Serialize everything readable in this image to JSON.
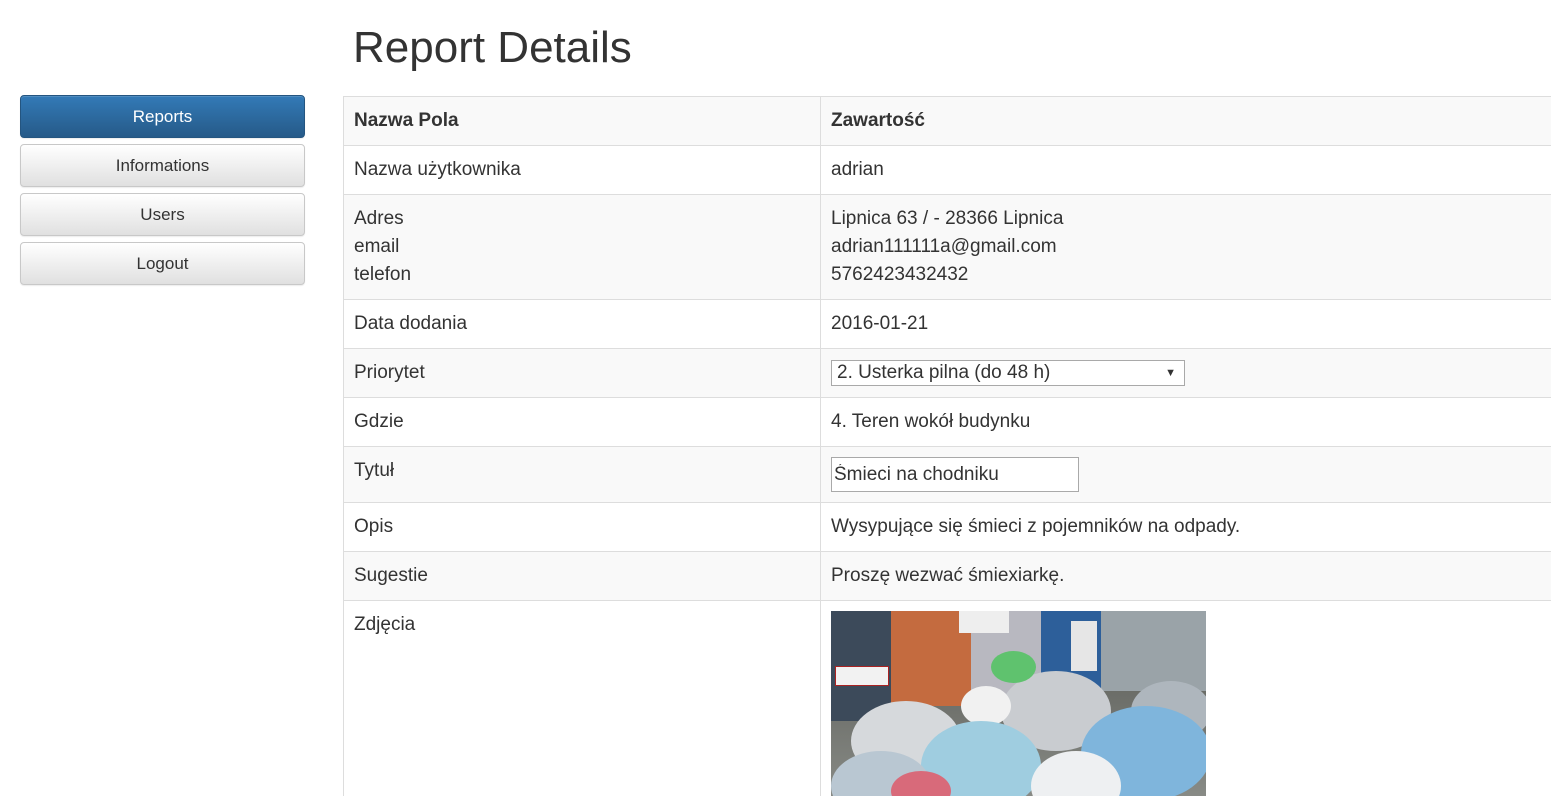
{
  "page": {
    "title": "Report Details"
  },
  "sidebar": {
    "items": [
      {
        "label": "Reports",
        "active": true
      },
      {
        "label": "Informations",
        "active": false
      },
      {
        "label": "Users",
        "active": false
      },
      {
        "label": "Logout",
        "active": false
      }
    ]
  },
  "table": {
    "headers": {
      "field": "Nazwa Pola",
      "content": "Zawartość"
    },
    "rows": {
      "username": {
        "label": "Nazwa użytkownika",
        "value": "adrian"
      },
      "contact": {
        "labels": [
          "Adres",
          "email",
          "telefon"
        ],
        "values": [
          "Lipnica 63 / - 28366 Lipnica",
          "adrian111111a@gmail.com",
          "5762423432432"
        ]
      },
      "date_added": {
        "label": "Data dodania",
        "value": "2016-01-21"
      },
      "priority": {
        "label": "Priorytet",
        "value": "2. Usterka pilna (do 48 h)"
      },
      "where": {
        "label": "Gdzie",
        "value": "4. Teren wokół budynku"
      },
      "title": {
        "label": "Tytuł",
        "value": "Śmieci na chodniku"
      },
      "description": {
        "label": "Opis",
        "value": "Wysypujące się śmieci z pojemników na odpady."
      },
      "suggestions": {
        "label": "Sugestie",
        "value": "Proszę wezwać śmiexiarkę."
      },
      "photos": {
        "label": "Zdjęcia"
      }
    }
  },
  "colors": {
    "active_nav": "#337ab7",
    "border": "#dddddd",
    "stripe": "#f9f9f9"
  }
}
